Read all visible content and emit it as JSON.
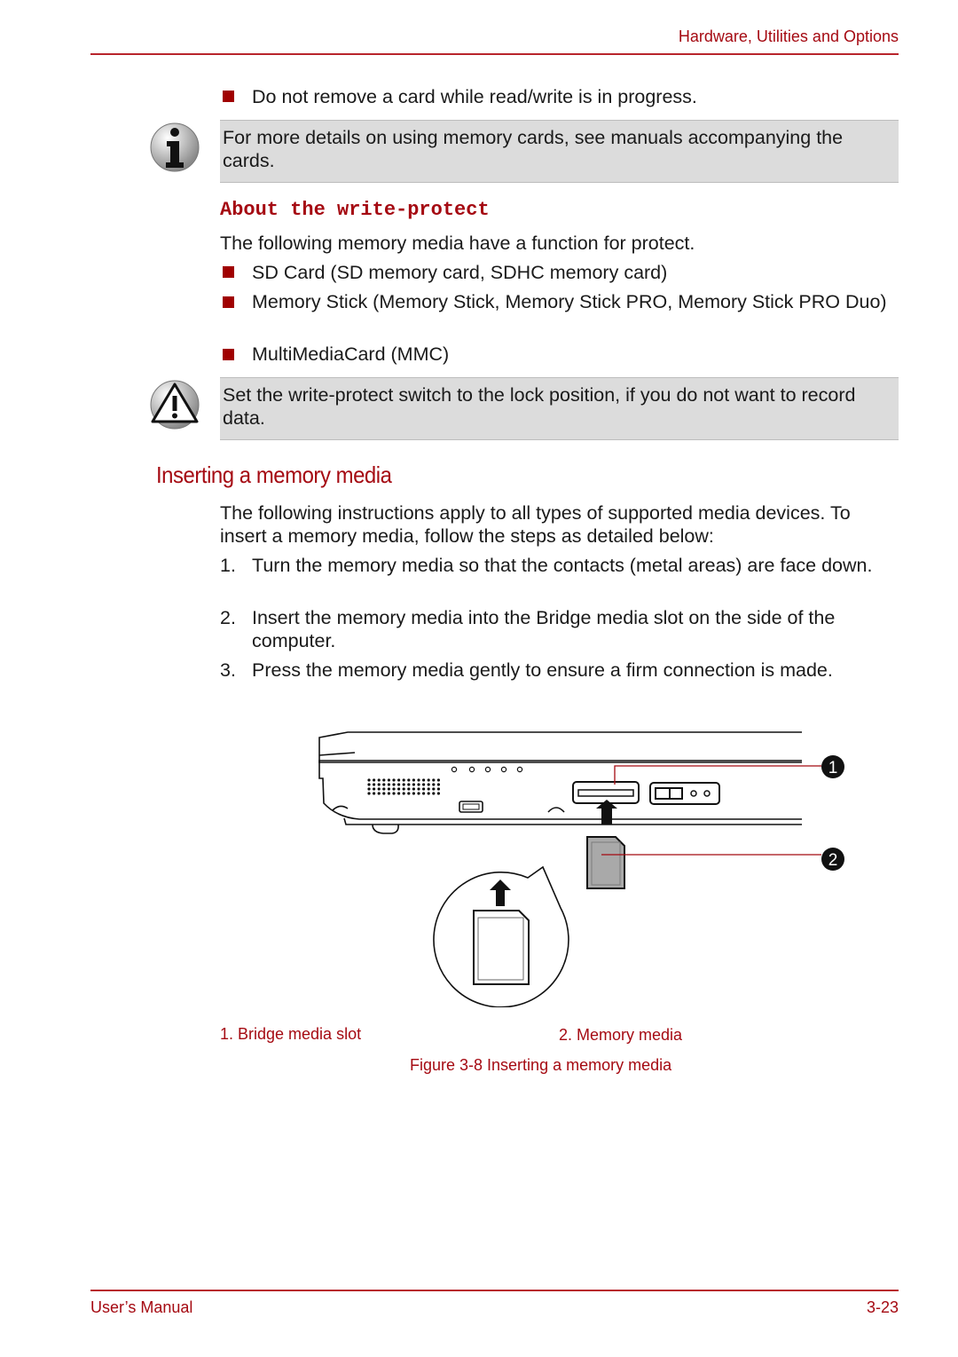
{
  "header": {
    "title": "Hardware, Utilities and Options"
  },
  "top_bullets": [
    "Do not remove a card while read/write is in progress."
  ],
  "info_note": {
    "icon": "info-icon",
    "text": "For more details on using memory cards, see manuals accompanying the cards."
  },
  "write_protect": {
    "heading": "About the write-protect",
    "intro": "The following memory media have a function for protect.",
    "bullets": [
      "SD Card (SD memory card, SDHC memory card)",
      "Memory Stick (Memory Stick, Memory Stick PRO, Memory Stick PRO Duo)",
      "MultiMediaCard (MMC)"
    ],
    "warning": {
      "icon": "warning-icon",
      "text": "Set the write-protect switch to the lock position, if you do not want to record data."
    }
  },
  "inserting": {
    "heading": "Inserting a memory media",
    "intro": "The following instructions apply to all types of supported media devices. To insert a memory media, follow the steps as detailed below:",
    "steps": [
      {
        "num": "1.",
        "text": "Turn the memory media so that the contacts (metal areas) are face down."
      },
      {
        "num": "2.",
        "text": "Insert the memory media into the Bridge media slot on the side of the computer."
      },
      {
        "num": "3.",
        "text": "Press the memory media gently to ensure a firm connection is made."
      }
    ]
  },
  "figure": {
    "callouts": [
      "1",
      "2"
    ],
    "legend": [
      "1. Bridge media slot",
      "2. Memory media"
    ],
    "caption": "Figure 3-8 Inserting a memory media",
    "accent_color": "#a50a12"
  },
  "footer": {
    "left": "User’s Manual",
    "right": "3-23"
  }
}
